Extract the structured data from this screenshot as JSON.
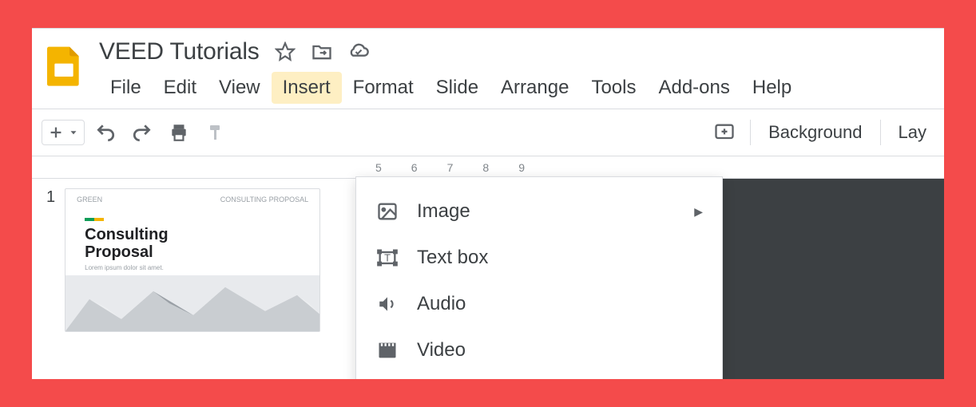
{
  "document": {
    "title": "VEED Tutorials"
  },
  "menubar": {
    "items": [
      "File",
      "Edit",
      "View",
      "Insert",
      "Format",
      "Slide",
      "Arrange",
      "Tools",
      "Add-ons",
      "Help"
    ],
    "active_index": 3
  },
  "toolbar": {
    "background_label": "Background",
    "layout_label": "Lay"
  },
  "ruler": {
    "start_tick": 5,
    "ticks": [
      "5",
      "6",
      "7",
      "8",
      "9"
    ]
  },
  "slide_panel": {
    "current_slide_number": "1",
    "thumb": {
      "header_left": "GREEN",
      "header_right": "CONSULTING PROPOSAL",
      "title_line1": "Consulting",
      "title_line2": "Proposal",
      "subtitle": "Lorem ipsum dolor sit amet."
    }
  },
  "insert_menu": {
    "items": [
      {
        "label": "Image",
        "icon": "image-icon",
        "has_submenu": true
      },
      {
        "label": "Text box",
        "icon": "textbox-icon",
        "has_submenu": false
      },
      {
        "label": "Audio",
        "icon": "audio-icon",
        "has_submenu": false
      },
      {
        "label": "Video",
        "icon": "video-icon",
        "has_submenu": false
      }
    ]
  }
}
